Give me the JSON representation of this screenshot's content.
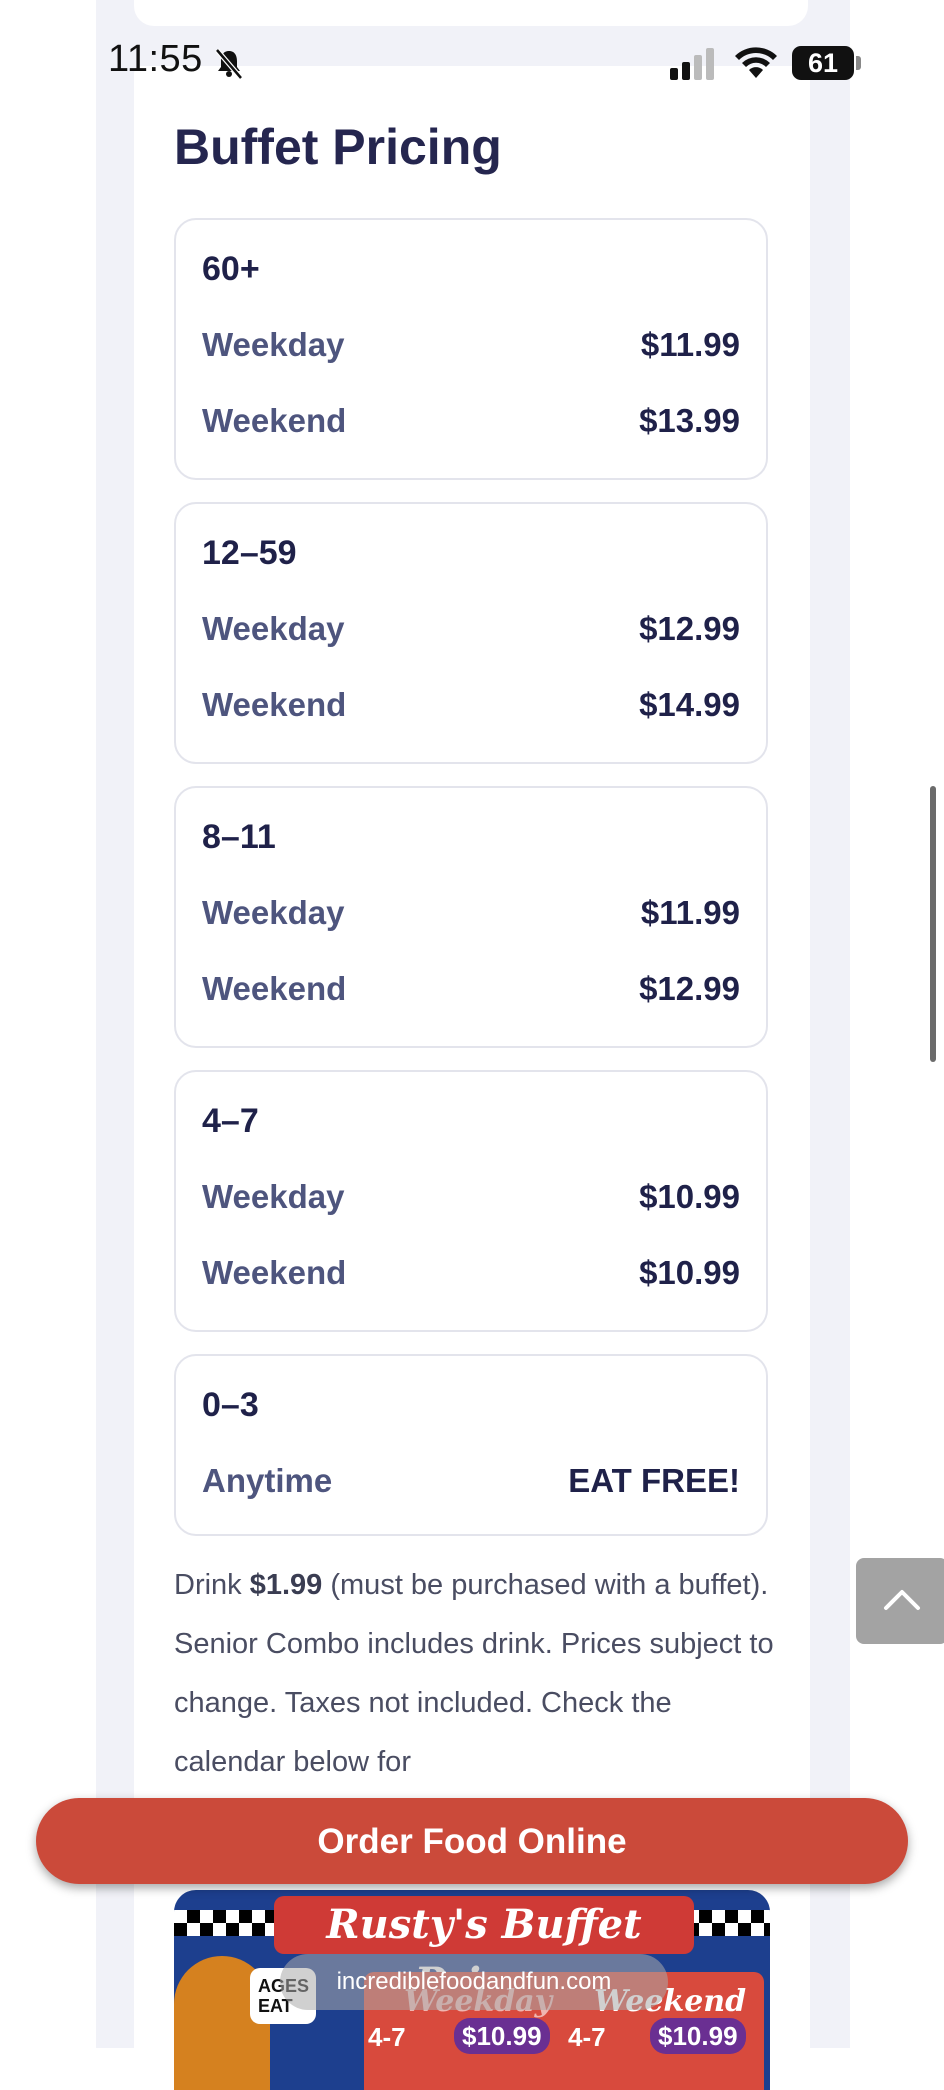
{
  "status_bar": {
    "time": "11:55",
    "battery": "61",
    "icons": [
      "bell-muted-icon",
      "signal-icon",
      "wifi-icon",
      "battery-icon"
    ]
  },
  "section": {
    "title": "Buffet Pricing"
  },
  "pricing": [
    {
      "label": "60+",
      "rows": [
        {
          "label": "Weekday",
          "price": "$11.99"
        },
        {
          "label": "Weekend",
          "price": "$13.99"
        }
      ]
    },
    {
      "label": "12–59",
      "rows": [
        {
          "label": "Weekday",
          "price": "$12.99"
        },
        {
          "label": "Weekend",
          "price": "$14.99"
        }
      ]
    },
    {
      "label": "8–11",
      "rows": [
        {
          "label": "Weekday",
          "price": "$11.99"
        },
        {
          "label": "Weekend",
          "price": "$12.99"
        }
      ]
    },
    {
      "label": "4–7",
      "rows": [
        {
          "label": "Weekday",
          "price": "$10.99"
        },
        {
          "label": "Weekend",
          "price": "$10.99"
        }
      ]
    },
    {
      "label": "0–3",
      "rows": [
        {
          "label": "Anytime",
          "price": "EAT FREE!"
        }
      ]
    }
  ],
  "note": {
    "prefix": "Drink ",
    "drink_price": "$1.99",
    "suffix": " (must be purchased with a buffet). Senior Combo includes drink. Prices subject to change. Taxes not included. Check the calendar below for"
  },
  "order_button": {
    "label": "Order Food Online"
  },
  "promo": {
    "title": "Rusty's Buffet Prices",
    "weekday": "Weekday",
    "weekend": "Weekend",
    "bubble": "AGES EAT",
    "age_left": "4-7",
    "price_left": "$10.99",
    "age_right": "4-7",
    "price_right": "$10.99"
  },
  "browser": {
    "url": "incrediblefoodandfun.com"
  },
  "colors": {
    "title": "#25264f",
    "label": "#4e557e",
    "price": "#1f2149",
    "button": "#cb4a3a"
  }
}
